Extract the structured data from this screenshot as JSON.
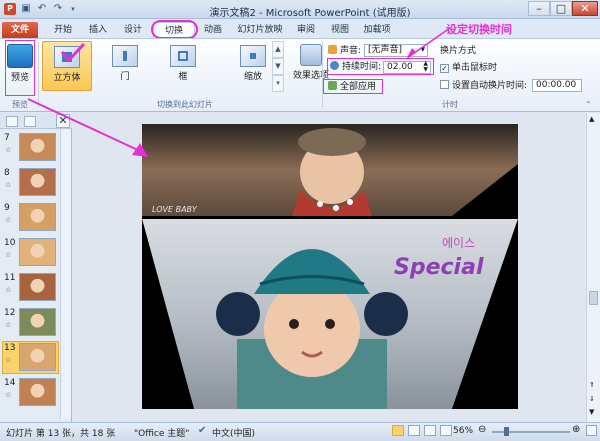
{
  "window": {
    "title": "演示文稿2 - Microsoft PowerPoint (试用版)",
    "app_logo": "P",
    "qat_icons": [
      "save-icon",
      "undo-icon",
      "redo-icon",
      "customize-icon"
    ],
    "controls": {
      "minimize": "–",
      "maximize": "□",
      "close": "✕"
    }
  },
  "tabs": [
    "文件",
    "开始",
    "插入",
    "设计",
    "切换",
    "动画",
    "幻灯片放映",
    "审阅",
    "视图",
    "加载项"
  ],
  "active_tab": "切换",
  "ribbon": {
    "preview_group": {
      "button_label": "预览",
      "group_label": "预览"
    },
    "transitions_group": {
      "effects": [
        "立方体",
        "门",
        "框",
        "缩放"
      ],
      "selected_effect": "立方体",
      "group_label": "切换到此幻灯片"
    },
    "effect_options_label": "效果选项",
    "timing_group": {
      "sound_label": "声音:",
      "sound_value": "[无声音]",
      "duration_label": "持续时间:",
      "duration_value": "02.00",
      "apply_all_label": "全部应用",
      "advance_heading": "换片方式",
      "on_click_label": "单击鼠标时",
      "on_click_checked": true,
      "after_label": "设置自动换片时间:",
      "after_checked": false,
      "after_value": "00:00.00",
      "group_label": "计时"
    }
  },
  "annotation": {
    "callout_text": "设定切换时间",
    "color": "#e52fd2"
  },
  "slide_pane": {
    "thumbnails": [
      {
        "number": "7",
        "selected": false
      },
      {
        "number": "8",
        "selected": false
      },
      {
        "number": "9",
        "selected": false
      },
      {
        "number": "10",
        "selected": false
      },
      {
        "number": "11",
        "selected": false
      },
      {
        "number": "12",
        "selected": false
      },
      {
        "number": "13",
        "selected": true
      },
      {
        "number": "14",
        "selected": false
      }
    ],
    "star_glyph": "☆"
  },
  "slide": {
    "top_panel_caption": "LOVE BABY",
    "bottom_panel_text": "Special",
    "bottom_panel_korean": "에이스"
  },
  "status_bar": {
    "slide_position": "幻灯片 第 13 张，共 18 张",
    "theme": "\"Office 主题\"",
    "language": "中文(中国)",
    "zoom": "56%"
  },
  "colors": {
    "accent": "#e52fd2",
    "file_tab": "#c23e1c",
    "selected_effect": "#fbc754"
  }
}
